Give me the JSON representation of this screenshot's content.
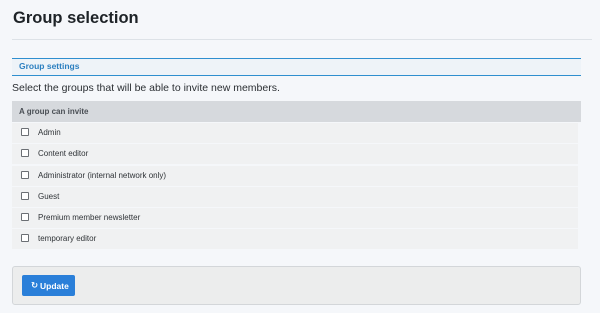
{
  "page": {
    "title": "Group selection"
  },
  "section": {
    "label": "Group settings"
  },
  "description": "Select the groups that will be able to invite new members.",
  "list": {
    "header": "A group can invite",
    "items": [
      {
        "label": "Admin",
        "checked": false
      },
      {
        "label": "Content editor",
        "checked": false
      },
      {
        "label": "Administrator (internal network only)",
        "checked": false
      },
      {
        "label": "Guest",
        "checked": false
      },
      {
        "label": "Premium member newsletter",
        "checked": false
      },
      {
        "label": "temporary editor",
        "checked": false
      }
    ]
  },
  "actions": {
    "update_label": "Update",
    "update_icon": "refresh-icon"
  },
  "colors": {
    "accent": "#2a7fd9",
    "section_rule": "#2f8fcf"
  }
}
